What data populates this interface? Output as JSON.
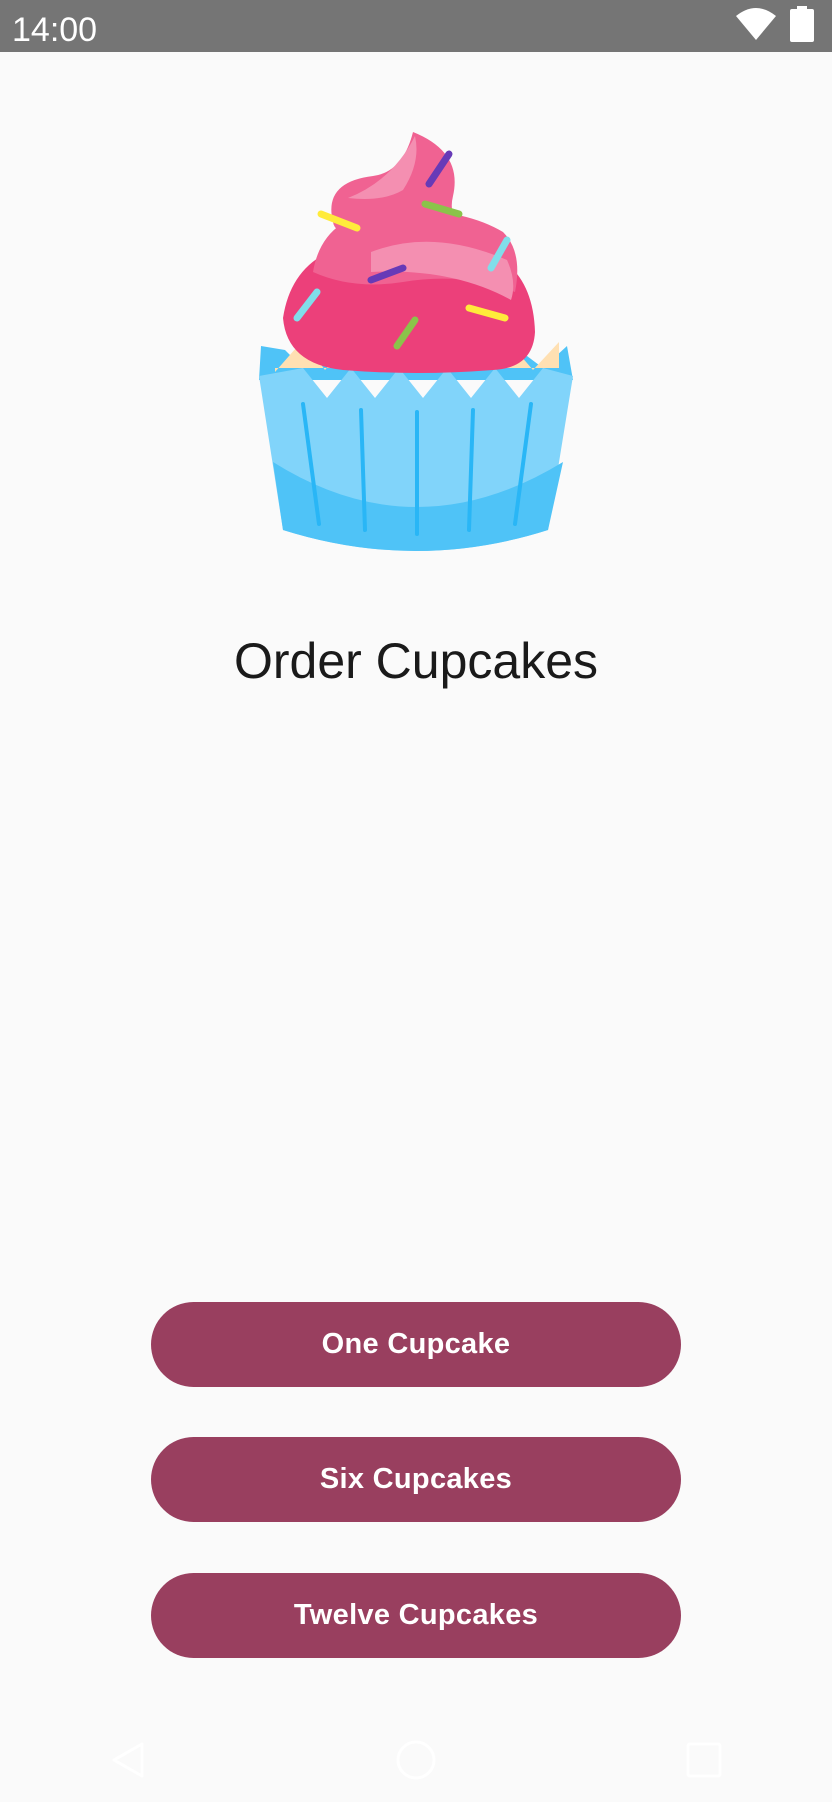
{
  "status_bar": {
    "time": "14:00",
    "icons": [
      "wifi-icon",
      "battery-icon"
    ]
  },
  "hero": {
    "image": "cupcake-illustration",
    "colors": {
      "frosting": "#f06292",
      "liner": "#81d4fa",
      "cake": "#ffe0b2"
    }
  },
  "title": "Order Cupcakes",
  "buttons": {
    "one": "One Cupcake",
    "six": "Six Cupcakes",
    "twelve": "Twelve Cupcakes"
  },
  "nav_bar": {
    "icons": [
      "back-icon",
      "home-icon",
      "recents-icon"
    ]
  },
  "colors": {
    "primary": "#993f5f",
    "status_bar": "#757575",
    "background": "#fafafa"
  }
}
